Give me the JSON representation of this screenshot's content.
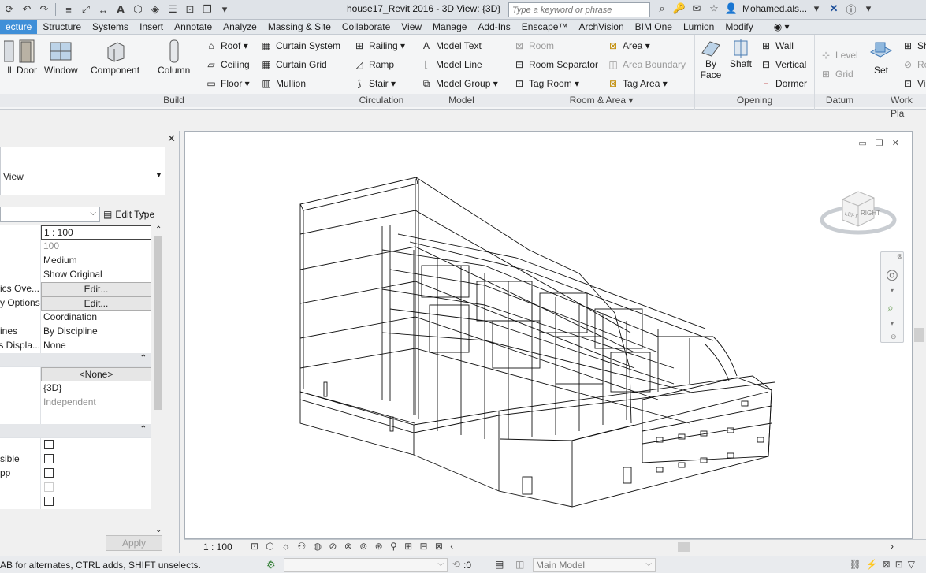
{
  "titlebar": {
    "doc_title": "house17_Revit 2016 - 3D View: {3D}",
    "search_placeholder": "Type a keyword or phrase",
    "user_name": "Mohamed.als..."
  },
  "tabs": [
    "ecture",
    "Structure",
    "Systems",
    "Insert",
    "Annotate",
    "Analyze",
    "Massing & Site",
    "Collaborate",
    "View",
    "Manage",
    "Add-Ins",
    "Enscape™",
    "ArchVision",
    "BIM One",
    "Lumion",
    "Modify"
  ],
  "ribbon": {
    "build": {
      "title": "Build",
      "wall": "ll",
      "door": "Door",
      "window": "Window",
      "component": "Component",
      "column": "Column",
      "roof": "Roof",
      "ceiling": "Ceiling",
      "floor": "Floor",
      "curtain_system": "Curtain System",
      "curtain_grid": "Curtain Grid",
      "mullion": "Mullion"
    },
    "circulation": {
      "title": "Circulation",
      "railing": "Railing",
      "ramp": "Ramp",
      "stair": "Stair"
    },
    "model": {
      "title": "Model",
      "model_text": "Model Text",
      "model_line": "Model Line",
      "model_group": "Model Group"
    },
    "room_area": {
      "title": "Room & Area",
      "room": "Room",
      "room_separator": "Room Separator",
      "tag_room": "Tag Room",
      "area": "Area",
      "area_boundary": "Area Boundary",
      "tag_area": "Tag Area"
    },
    "opening": {
      "title": "Opening",
      "by_face": "By Face",
      "shaft": "Shaft",
      "wall": "Wall",
      "vertical": "Vertical",
      "dormer": "Dormer"
    },
    "datum": {
      "title": "Datum",
      "level": "Level",
      "grid": "Grid"
    },
    "work_plane": {
      "title": "Work Pla",
      "set": "Set",
      "show": "Sh",
      "ref": "Re",
      "viewer": "Vi"
    }
  },
  "properties": {
    "type_name": "View",
    "edit_type": "Edit Type",
    "rows": [
      {
        "k": "",
        "v": "1 : 100",
        "kind": "input"
      },
      {
        "k": "",
        "v": "100",
        "kind": "grey"
      },
      {
        "k": "",
        "v": "Medium",
        "kind": "text"
      },
      {
        "k": "",
        "v": "Show Original",
        "kind": "text"
      },
      {
        "k": "ics Ove...",
        "v": "Edit...",
        "kind": "button"
      },
      {
        "k": "y Options",
        "v": "Edit...",
        "kind": "button"
      },
      {
        "k": "",
        "v": "Coordination",
        "kind": "text"
      },
      {
        "k": "ines",
        "v": "By Discipline",
        "kind": "text"
      },
      {
        "k": "s Displa...",
        "v": "None",
        "kind": "text"
      },
      {
        "k": "",
        "v": "",
        "kind": "group"
      },
      {
        "k": "",
        "v": "<None>",
        "kind": "button"
      },
      {
        "k": "",
        "v": "{3D}",
        "kind": "text"
      },
      {
        "k": "",
        "v": "Independent",
        "kind": "grey"
      },
      {
        "k": "",
        "v": "",
        "kind": "text"
      },
      {
        "k": "",
        "v": "",
        "kind": "group"
      },
      {
        "k": "",
        "v": "",
        "kind": "check"
      },
      {
        "k": "sible",
        "v": "",
        "kind": "check"
      },
      {
        "k": "pp",
        "v": "",
        "kind": "check"
      },
      {
        "k": "",
        "v": "",
        "kind": "checkdim"
      },
      {
        "k": "",
        "v": "",
        "kind": "check"
      }
    ],
    "apply": "Apply"
  },
  "viewcube": {
    "face_front": "LEFT",
    "face_right": "RIGHT"
  },
  "viewbar": {
    "scale": "1 : 100"
  },
  "statusbar": {
    "hint": "AB for alternates, CTRL adds, SHIFT unselects.",
    "zero": ":0",
    "model": "Main Model"
  },
  "colors": {
    "accent": "#3f8fd8",
    "ribbon_bg": "#f4f5f6"
  }
}
